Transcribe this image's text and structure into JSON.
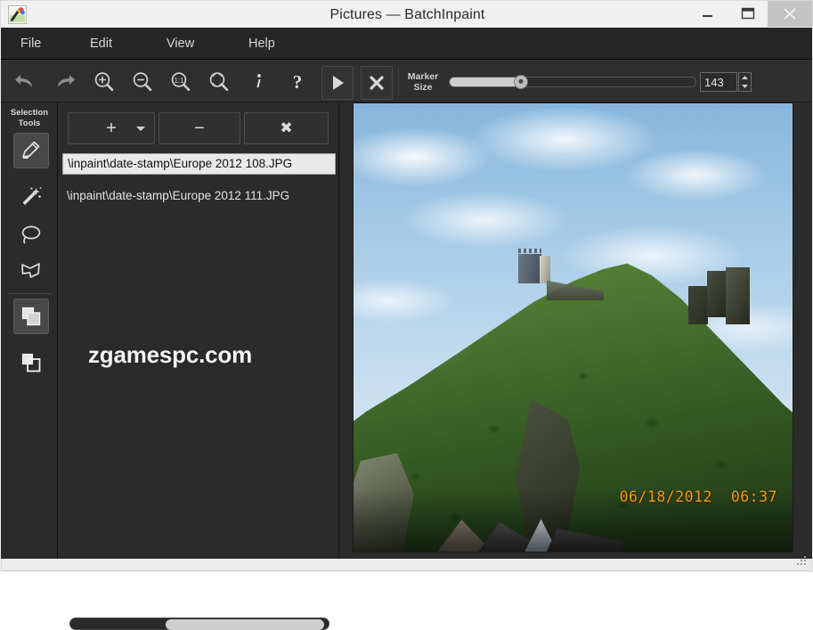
{
  "window": {
    "title": "Pictures — BatchInpaint",
    "app_icon": "app-image-brush-icon",
    "controls": {
      "minimize": "minimize-icon",
      "maximize": "maximize-icon",
      "close": "close-icon"
    }
  },
  "menubar": {
    "items": [
      {
        "label": "File",
        "name": "menu-file"
      },
      {
        "label": "Edit",
        "name": "menu-edit"
      },
      {
        "label": "View",
        "name": "menu-view"
      },
      {
        "label": "Help",
        "name": "menu-help"
      }
    ]
  },
  "toolbar": {
    "buttons": [
      {
        "name": "undo-button",
        "icon": "undo-arrow-icon"
      },
      {
        "name": "redo-button",
        "icon": "redo-arrow-icon"
      },
      {
        "name": "zoom-in-button",
        "icon": "magnifier-plus-icon"
      },
      {
        "name": "zoom-out-button",
        "icon": "magnifier-minus-icon"
      },
      {
        "name": "zoom-actual-button",
        "icon": "magnifier-one-to-one-icon"
      },
      {
        "name": "zoom-fit-button",
        "icon": "magnifier-fit-icon"
      },
      {
        "name": "info-button",
        "icon": "info-i-icon"
      },
      {
        "name": "help-button",
        "icon": "question-mark-icon"
      },
      {
        "name": "run-button",
        "icon": "play-triangle-icon"
      },
      {
        "name": "stop-button",
        "icon": "cross-x-icon"
      }
    ],
    "marker_size": {
      "label_line1": "Marker",
      "label_line2": "Size",
      "value": "143",
      "slider_percent": 28
    }
  },
  "selection_tools": {
    "title_line1": "Selection",
    "title_line2": "Tools",
    "tools": [
      {
        "name": "marker-tool",
        "icon": "marker-pen-icon",
        "active": true
      },
      {
        "name": "magic-wand-tool",
        "icon": "magic-wand-icon",
        "active": false
      },
      {
        "name": "lasso-tool",
        "icon": "lasso-loop-icon",
        "active": false
      },
      {
        "name": "polygon-lasso-tool",
        "icon": "polygon-lasso-icon",
        "active": false
      },
      {
        "name": "filled-layers-tool",
        "icon": "filled-layers-icon",
        "active": true
      },
      {
        "name": "outline-layers-tool",
        "icon": "outline-layers-icon",
        "active": false
      }
    ]
  },
  "file_panel": {
    "buttons": [
      {
        "name": "add-files-button",
        "glyph": "+",
        "icon": "plus-icon"
      },
      {
        "name": "remove-file-button",
        "glyph": "−",
        "icon": "minus-icon"
      },
      {
        "name": "clear-list-button",
        "glyph": "✖",
        "icon": "cross-x-icon"
      }
    ],
    "files": [
      {
        "path": "\\inpaint\\date-stamp\\Europe 2012 108.JPG",
        "selected": true
      },
      {
        "path": "\\inpaint\\date-stamp\\Europe 2012 111.JPG",
        "selected": false
      }
    ],
    "watermark": "zgamespc.com",
    "scrollbar": {
      "name": "horizontal-scrollbar",
      "thumb_percent": 61
    }
  },
  "canvas": {
    "name": "image-preview",
    "datestamp": "06/18/2012  06:37",
    "datestamp_color": "#f0a010",
    "description": "Castle ruin on a forested hill under a blue cloudy sky with village rooftops at the bottom"
  },
  "statusbar": {
    "resize_grip": "resize-grip-icon"
  },
  "colors": {
    "titlebar_bg": "#f0f0f0",
    "menubar_bg": "#262626",
    "toolbar_bg": "#2f2f2f",
    "panel_bg": "#2b2b2b",
    "selected_item_bg": "#e9e9e9",
    "accent_text": "#d6d6d6"
  }
}
